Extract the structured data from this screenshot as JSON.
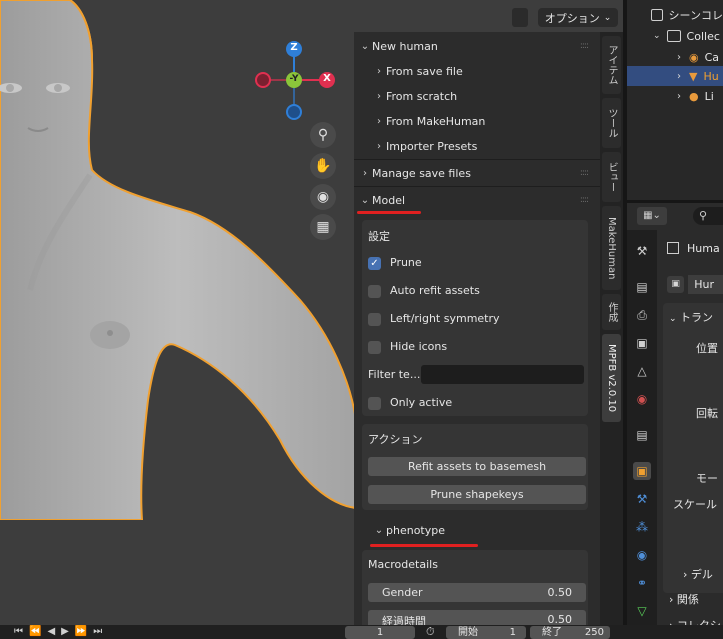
{
  "viewport": {
    "options_label": "オプション",
    "gizmo": {
      "z": "Z",
      "y": "-Y",
      "x": "X"
    },
    "nav_icons": [
      "zoom-icon",
      "hand-pan-icon",
      "camera-icon",
      "grid-icon"
    ]
  },
  "npanel": {
    "new_human": {
      "label": "New human",
      "items": [
        "From save file",
        "From scratch",
        "From MakeHuman",
        "Importer Presets"
      ]
    },
    "manage_save_files": "Manage save files",
    "model": {
      "label": "Model",
      "settings_title": "設定",
      "options": [
        {
          "label": "Prune",
          "checked": true
        },
        {
          "label": "Auto refit assets",
          "checked": false
        },
        {
          "label": "Left/right symmetry",
          "checked": false
        },
        {
          "label": "Hide icons",
          "checked": false
        }
      ],
      "filter_label": "Filter te...",
      "filter_value": "",
      "only_active": {
        "label": "Only active",
        "checked": false
      },
      "actions_title": "アクション",
      "refit_button": "Refit assets to basemesh",
      "prune_button": "Prune shapekeys"
    },
    "phenotype": {
      "label": "phenotype",
      "macrodetails_title": "Macrodetails",
      "gender_label": "Gender",
      "gender_value": "0.50",
      "age_label": "経過時間",
      "age_value": "0.50"
    }
  },
  "tabs": [
    "アイテム",
    "ツール",
    "ビュー",
    "MakeHuman",
    "作成",
    "MPFB v2.0.10"
  ],
  "outliner": {
    "scene_label": "シーンコレ",
    "collection_label": "Collec",
    "items": [
      "Ca",
      "Hu",
      "Li"
    ]
  },
  "properties": {
    "object_name": "Huma",
    "object_field": "Hur",
    "transform_label": "トラン",
    "location_label": "位置",
    "rotation_label": "回転",
    "mode_label": "モー",
    "scale_label": "スケール",
    "delta_label": "デル",
    "relations_label": "関係",
    "collections_label": "コレクシ"
  },
  "timeline": {
    "current_frame": "1",
    "start_label": "開始",
    "start_value": "1",
    "end_label": "終了",
    "end_value": "250"
  },
  "colors": {
    "accent": "#4772b3",
    "selection_outline": "#f0a030",
    "annotation_red": "#e02020",
    "gizmo_z": "#2f7fd8",
    "gizmo_y": "#8bc53a",
    "gizmo_x": "#e03050"
  }
}
